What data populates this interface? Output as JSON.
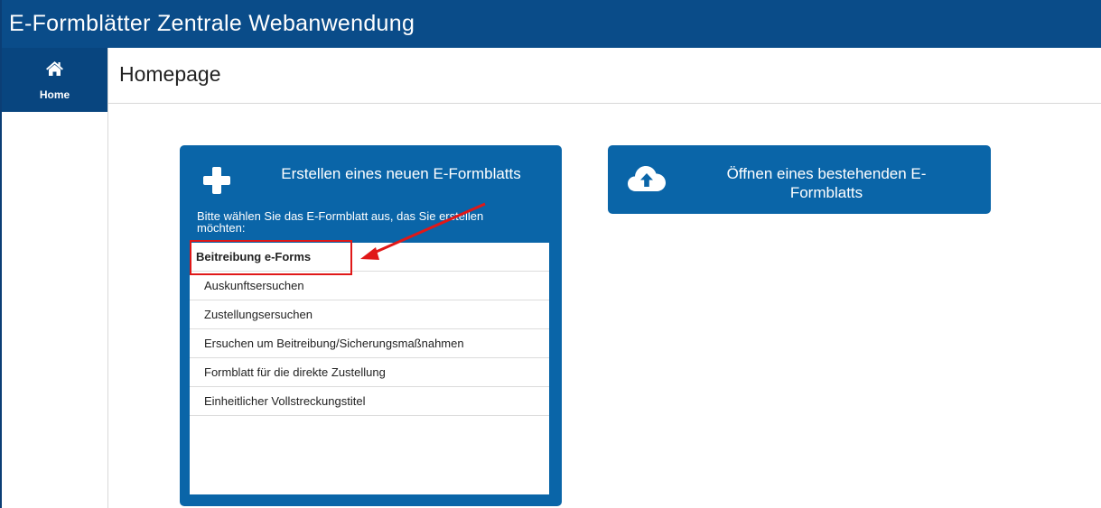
{
  "app": {
    "title": "E-Formblätter Zentrale Webanwendung"
  },
  "sidebar": {
    "items": [
      {
        "label": "Home",
        "icon": "home-icon"
      }
    ]
  },
  "page": {
    "title": "Homepage"
  },
  "create_card": {
    "icon": "plus-icon",
    "title": "Erstellen eines neuen E-Formblatts",
    "hint": "Bitte wählen Sie das E-Formblatt aus, das Sie erstellen möchten:",
    "list": {
      "group_label": "Beitreibung e-Forms",
      "items": [
        "Auskunftsersuchen",
        "Zustellungsersuchen",
        "Ersuchen um Beitreibung/Sicherungsmaßnahmen",
        "Formblatt für die direkte Zustellung",
        "Einheitlicher Vollstreckungstitel"
      ]
    }
  },
  "open_card": {
    "icon": "cloud-upload-icon",
    "title": "Öffnen eines bestehenden E-Formblatts"
  },
  "colors": {
    "titlebar": "#0a4c89",
    "nav_active": "#08457f",
    "card": "#0a65a8",
    "annotation": "#e01818"
  }
}
